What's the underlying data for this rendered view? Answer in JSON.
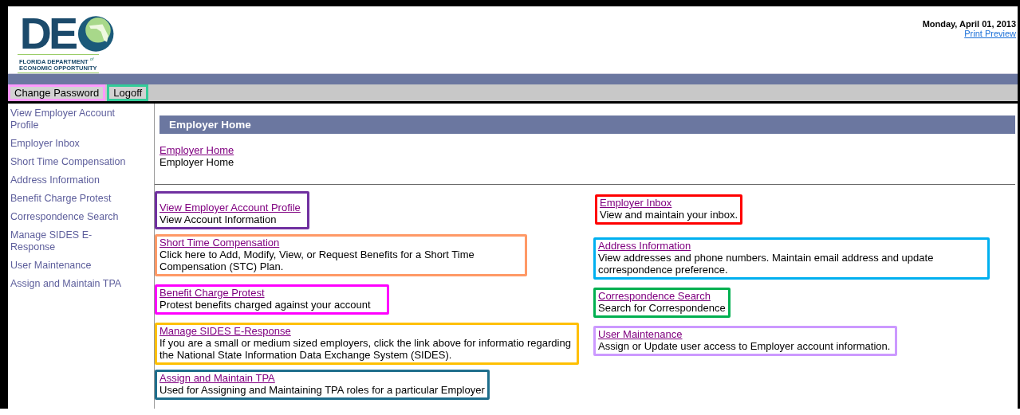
{
  "logo": {
    "mark": "DE",
    "line_1": "FLORIDA DEPARTMENT",
    "line_1_small": "of",
    "line_2": "ECONOMIC OPPORTUNITY"
  },
  "header": {
    "date": "Monday, April 01, 2013",
    "print_link": "Print Preview"
  },
  "nav_buttons": [
    {
      "label": "Change Password",
      "color": "#ff99ff"
    },
    {
      "label": "Logoff",
      "color": "#33cc99"
    }
  ],
  "sidebar": {
    "items": [
      {
        "label": "View Employer Account Profile"
      },
      {
        "label": "Employer Inbox"
      },
      {
        "label": "Short Time Compensation"
      },
      {
        "label": "Address Information"
      },
      {
        "label": "Benefit Charge Protest"
      },
      {
        "label": "Correspondence Search"
      },
      {
        "label": "Manage SIDES E-Response"
      },
      {
        "label": "User Maintenance"
      },
      {
        "label": "Assign and Maintain TPA"
      }
    ]
  },
  "page_title": "Employer Home",
  "breadcrumb": {
    "link": "Employer Home",
    "text": "Employer Home"
  },
  "cards": [
    {
      "link": "View Employer Account Profile",
      "description": "View Account Information",
      "color": "#7030a0"
    },
    {
      "link": "Employer Inbox",
      "description": "View and maintain your inbox.",
      "color": "#ff0000"
    },
    {
      "link": "Short Time Compensation",
      "description": "Click here to Add, Modify, View, or Request Benefits for a Short Time Compensation (STC) Plan.",
      "color": "#ff9966"
    },
    {
      "link": "Address Information",
      "description": "View addresses and phone numbers. Maintain email address and update correspondence preference.",
      "color": "#00b0f0"
    },
    {
      "link": "Benefit Charge Protest",
      "description": "Protest benefits charged against your account",
      "color": "#ff00ff"
    },
    {
      "link": "Correspondence Search",
      "description": "Search for Correspondence",
      "color": "#00b050"
    },
    {
      "link": "Manage SIDES E-Response",
      "description": "If you are a small or medium sized employers, click the link above for informatio regarding the National State Information Data Exchange System (SIDES).",
      "color": "#ffc000"
    },
    {
      "link": "User Maintenance",
      "description": "Assign or Update user access to Employer account information.",
      "color": "#cc99ff"
    },
    {
      "link": "Assign and Maintain TPA",
      "description": "Used for Assigning and Maintaining TPA roles for a particular Employer",
      "color": "#1f6e8c"
    }
  ]
}
